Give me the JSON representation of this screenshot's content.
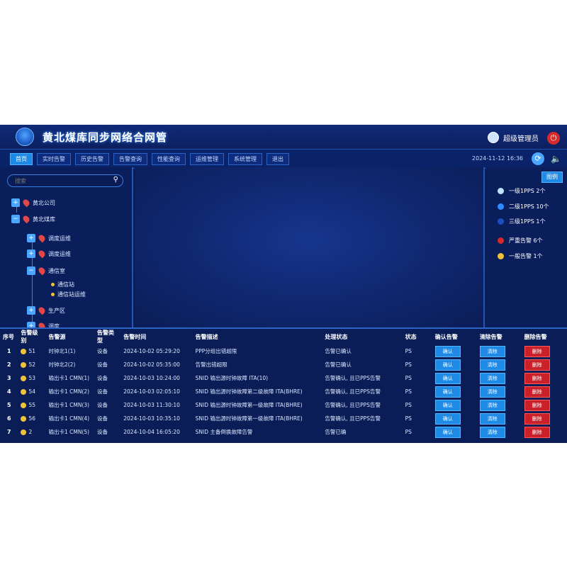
{
  "header": {
    "title": "黄北煤库同步网络合网管",
    "user_name": "超级管理员",
    "power_icon": "power-icon",
    "logo_icon": "logo-icon"
  },
  "nav": {
    "tabs": [
      {
        "label": "首页",
        "active": true
      },
      {
        "label": "实时告警",
        "active": false
      },
      {
        "label": "历史告警",
        "active": false
      },
      {
        "label": "告警查询",
        "active": false
      },
      {
        "label": "性能查询",
        "active": false
      },
      {
        "label": "运维管理",
        "active": false
      },
      {
        "label": "系统管理",
        "active": false
      },
      {
        "label": "退出",
        "active": false
      }
    ],
    "datetime": "2024-11-12 16:36"
  },
  "search": {
    "placeholder": "搜索"
  },
  "tree": [
    {
      "label": "黄北公司",
      "level": 0,
      "toggle": "+"
    },
    {
      "label": "黄北煤库",
      "level": 0,
      "toggle": "-"
    },
    {
      "label": "调度运维",
      "level": 1,
      "toggle": "+"
    },
    {
      "label": "调度运维",
      "level": 1,
      "toggle": "+"
    },
    {
      "label": "通信室",
      "level": 1,
      "toggle": "-"
    },
    {
      "label": "通信站",
      "level": 2,
      "toggle": ""
    },
    {
      "label": "通信站运维",
      "level": 2,
      "toggle": ""
    },
    {
      "label": "生产区",
      "level": 1,
      "toggle": "+"
    },
    {
      "label": "调度",
      "level": 1,
      "toggle": "+"
    }
  ],
  "legend": {
    "button": "图例",
    "items": [
      {
        "label": "一级1PPS 2个",
        "color": "#bfe3ff"
      },
      {
        "label": "二级1PPS 10个",
        "color": "#2f8cff"
      },
      {
        "label": "三级1PPS 1个",
        "color": "#1a4fc0"
      },
      {
        "label": "严重告警 6个",
        "color": "#d42a2a"
      },
      {
        "label": "一般告警 1个",
        "color": "#f0c23a"
      }
    ]
  },
  "table": {
    "headers": [
      "序号",
      "告警级别",
      "告警源",
      "告警类型",
      "告警时间",
      "告警描述",
      "处理状态",
      "状态",
      "确认告警",
      "清除告警",
      "删除告警"
    ],
    "rows": [
      {
        "no": "1",
        "level": "51",
        "source": "时钟北1(1)",
        "type": "设备",
        "time": "2024-10-02 05:29:20",
        "desc": "PPP分组出错超限",
        "status": "告警已确认",
        "state": "PS"
      },
      {
        "no": "2",
        "level": "52",
        "source": "时钟北2(2)",
        "type": "设备",
        "time": "2024-10-02 05:35:00",
        "desc": "告警出错超限",
        "status": "告警已确认",
        "state": "PS"
      },
      {
        "no": "3",
        "level": "53",
        "source": "输出卡1 CMN(1)",
        "type": "设备",
        "time": "2024-10-03 10:24:00",
        "desc": "SNID 输出源时钟故障 ITA(10)",
        "status": "告警确认, 且已PPS告警",
        "state": "PS"
      },
      {
        "no": "4",
        "level": "54",
        "source": "输出卡1 CMN(2)",
        "type": "设备",
        "time": "2024-10-03 02:05:10",
        "desc": "SNID 输出源时钟故障第二级故障 ITA(BHRE)",
        "status": "告警确认, 且已PPS告警",
        "state": "PS"
      },
      {
        "no": "5",
        "level": "55",
        "source": "输出卡1 CMN(3)",
        "type": "设备",
        "time": "2024-10-03 11:30:10",
        "desc": "SNID 输出源时钟故障第一级故障 ITA(BHRE)",
        "status": "告警确认, 且已PPS告警",
        "state": "PS"
      },
      {
        "no": "6",
        "level": "56",
        "source": "输出卡1 CMN(4)",
        "type": "设备",
        "time": "2024-10-03 10:35:10",
        "desc": "SNID 输出源时钟故障第一级故障 ITA(BHRE)",
        "status": "告警确认, 且已PPS告警",
        "state": "PS"
      },
      {
        "no": "7",
        "level": "2",
        "source": "输出卡1 CMN(5)",
        "type": "设备",
        "time": "2024-10-04 16:05:20",
        "desc": "SNID 主备倒换故障告警",
        "status": "告警已确",
        "state": "PS"
      }
    ],
    "confirm_label": "确认",
    "clear_label": "清除",
    "delete_label": "删除"
  },
  "colors": {
    "background": "#0b1d57",
    "accent": "#1f8ae6",
    "danger": "#c9202a",
    "warning": "#f0c23a"
  }
}
